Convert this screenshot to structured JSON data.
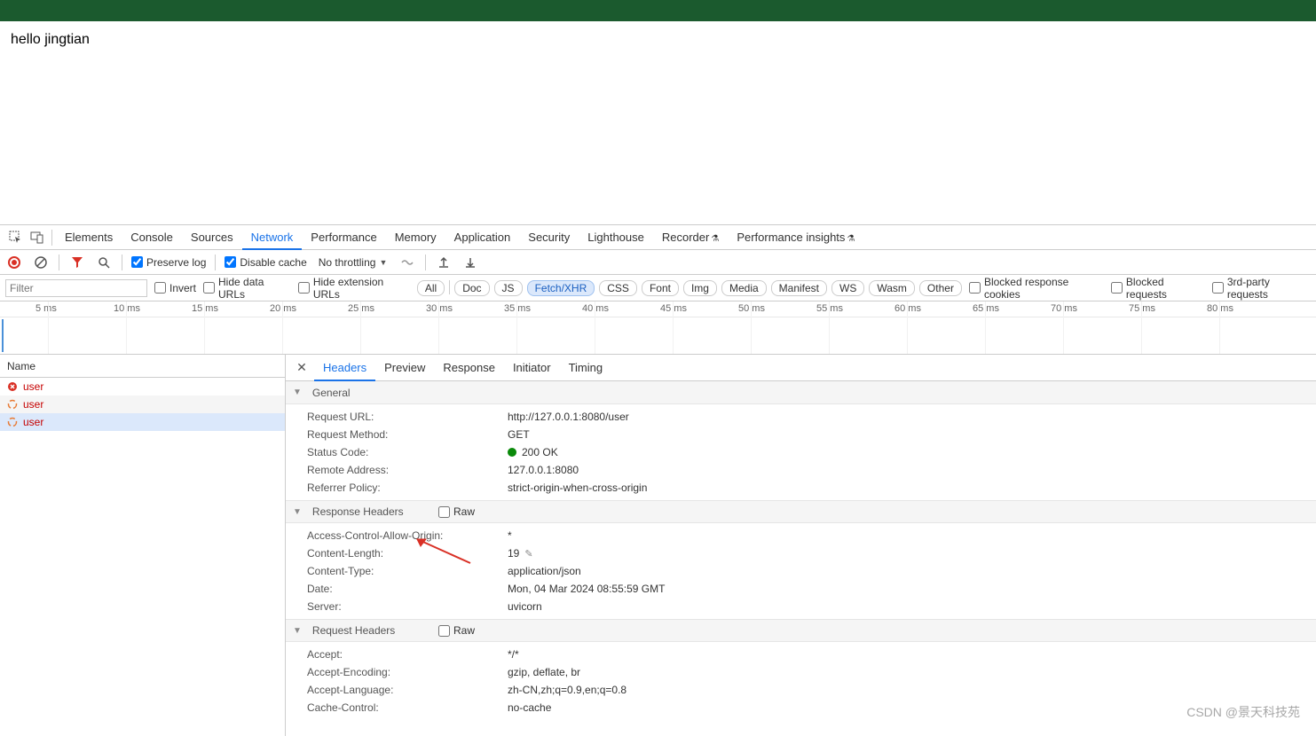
{
  "page": {
    "body_text": "hello jingtian"
  },
  "devtools_tabs": {
    "elements": "Elements",
    "console": "Console",
    "sources": "Sources",
    "network": "Network",
    "performance": "Performance",
    "memory": "Memory",
    "application": "Application",
    "security": "Security",
    "lighthouse": "Lighthouse",
    "recorder": "Recorder",
    "perf_insights": "Performance insights"
  },
  "net_toolbar": {
    "preserve_log": "Preserve log",
    "disable_cache": "Disable cache",
    "throttling": "No throttling"
  },
  "filter_bar": {
    "filter_placeholder": "Filter",
    "invert": "Invert",
    "hide_data_urls": "Hide data URLs",
    "hide_ext_urls": "Hide extension URLs",
    "types": {
      "all": "All",
      "doc": "Doc",
      "js": "JS",
      "fetch": "Fetch/XHR",
      "css": "CSS",
      "font": "Font",
      "img": "Img",
      "media": "Media",
      "manifest": "Manifest",
      "ws": "WS",
      "wasm": "Wasm",
      "other": "Other"
    },
    "blocked_cookies": "Blocked response cookies",
    "blocked_requests": "Blocked requests",
    "third_party": "3rd-party requests"
  },
  "timeline_ticks": [
    "5 ms",
    "10 ms",
    "15 ms",
    "20 ms",
    "25 ms",
    "30 ms",
    "35 ms",
    "40 ms",
    "45 ms",
    "50 ms",
    "55 ms",
    "60 ms",
    "65 ms",
    "70 ms",
    "75 ms",
    "80 ms"
  ],
  "reqlist": {
    "col_name": "Name",
    "rows": [
      {
        "name": "user",
        "status": "error"
      },
      {
        "name": "user",
        "status": "pending"
      },
      {
        "name": "user",
        "status": "pending",
        "selected": true
      }
    ]
  },
  "detail_tabs": {
    "headers": "Headers",
    "preview": "Preview",
    "response": "Response",
    "initiator": "Initiator",
    "timing": "Timing"
  },
  "sections": {
    "general": "General",
    "response_headers": "Response Headers",
    "request_headers": "Request Headers",
    "raw_label": "Raw"
  },
  "general": {
    "request_url_k": "Request URL:",
    "request_url_v": "http://127.0.0.1:8080/user",
    "request_method_k": "Request Method:",
    "request_method_v": "GET",
    "status_code_k": "Status Code:",
    "status_code_v": "200 OK",
    "remote_addr_k": "Remote Address:",
    "remote_addr_v": "127.0.0.1:8080",
    "referrer_policy_k": "Referrer Policy:",
    "referrer_policy_v": "strict-origin-when-cross-origin"
  },
  "response_headers": {
    "acao_k": "Access-Control-Allow-Origin:",
    "acao_v": "*",
    "clen_k": "Content-Length:",
    "clen_v": "19",
    "ctype_k": "Content-Type:",
    "ctype_v": "application/json",
    "date_k": "Date:",
    "date_v": "Mon, 04 Mar 2024 08:55:59 GMT",
    "server_k": "Server:",
    "server_v": "uvicorn"
  },
  "request_headers": {
    "accept_k": "Accept:",
    "accept_v": "*/*",
    "aenc_k": "Accept-Encoding:",
    "aenc_v": "gzip, deflate, br",
    "alang_k": "Accept-Language:",
    "alang_v": "zh-CN,zh;q=0.9,en;q=0.8",
    "cache_k": "Cache-Control:",
    "cache_v": "no-cache"
  },
  "watermark": "CSDN @景天科技苑"
}
